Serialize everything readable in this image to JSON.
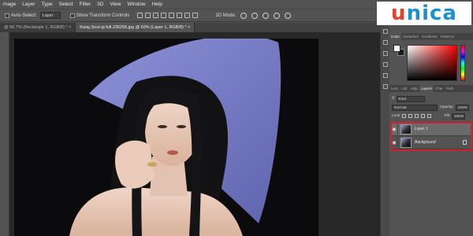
{
  "menu": [
    "mage",
    "Layer",
    "Type",
    "Select",
    "Filter",
    "3D",
    "View",
    "Window",
    "Help"
  ],
  "options": {
    "auto_select_label": "Auto-Select:",
    "auto_select_value": "Layer",
    "transform_label": "Show Transform Controls",
    "mode_3d_label": "3D Mode:"
  },
  "tabs": [
    {
      "label": "@ 66.7% (Rectangle 1, RGB/8) *  ×",
      "active": false
    },
    {
      "label": "Kang.Seul-gi.full.236256.jpg @ 50% (Layer 1, RGB/8) *  ×",
      "active": true
    }
  ],
  "color_panel": {
    "tabs": [
      "Color",
      "Swatches",
      "Gradients",
      "Patterns"
    ],
    "foreground": "#ffffff",
    "background": "#1a1a1a"
  },
  "layers_panel": {
    "tabs": [
      "Lear",
      "Libr",
      "Adju",
      "Layers",
      "Char",
      "Path"
    ],
    "active_tab": "Layers",
    "kind_label": "Kind",
    "blend_mode": "Normal",
    "opacity_label": "Opacity:",
    "opacity_value": "100%",
    "lock_label": "Lock:",
    "fill_label": "Fill:",
    "fill_value": "100%",
    "layers": [
      {
        "name": "Layer 1",
        "selected": true,
        "italic": false,
        "locked": false
      },
      {
        "name": "Background",
        "selected": false,
        "italic": true,
        "locked": true
      }
    ]
  },
  "logo": {
    "part1": "u",
    "part2": "nica"
  },
  "colors": {
    "highlight": "#d3202e",
    "logo_blue": "#1b8fd1",
    "logo_red": "#e2412c",
    "hat": "#7b80c8"
  }
}
